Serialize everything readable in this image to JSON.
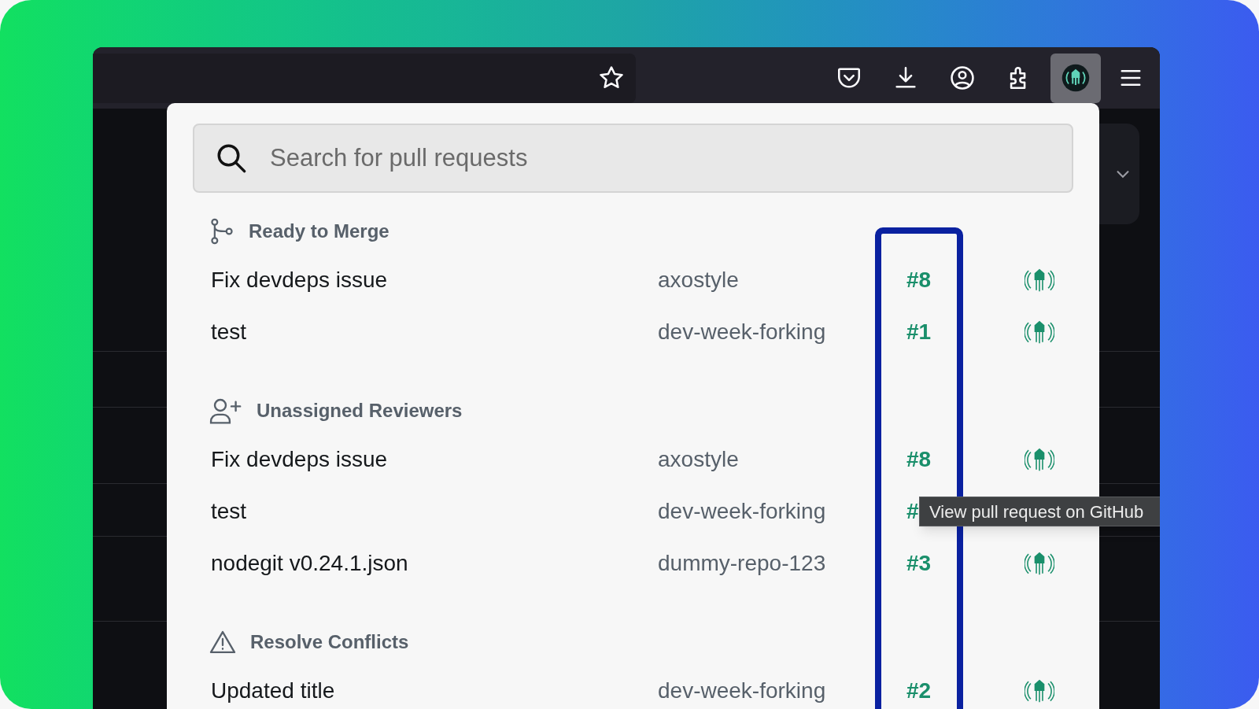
{
  "search": {
    "placeholder": "Search for pull requests"
  },
  "sections": [
    {
      "kind": "merge",
      "title": "Ready to Merge",
      "rows": [
        {
          "title": "Fix devdeps issue",
          "repo": "axostyle",
          "number": "#8"
        },
        {
          "title": "test",
          "repo": "dev-week-forking",
          "number": "#1"
        }
      ]
    },
    {
      "kind": "reviewers",
      "title": "Unassigned Reviewers",
      "rows": [
        {
          "title": "Fix devdeps issue",
          "repo": "axostyle",
          "number": "#8"
        },
        {
          "title": "test",
          "repo": "dev-week-forking",
          "number": "#"
        },
        {
          "title": "nodegit v0.24.1.json",
          "repo": "dummy-repo-123",
          "number": "#3"
        }
      ]
    },
    {
      "kind": "conflicts",
      "title": "Resolve Conflicts",
      "rows": [
        {
          "title": "Updated title",
          "repo": "dev-week-forking",
          "number": "#2"
        }
      ]
    }
  ],
  "tooltip": {
    "text": "View pull request on GitHub"
  }
}
